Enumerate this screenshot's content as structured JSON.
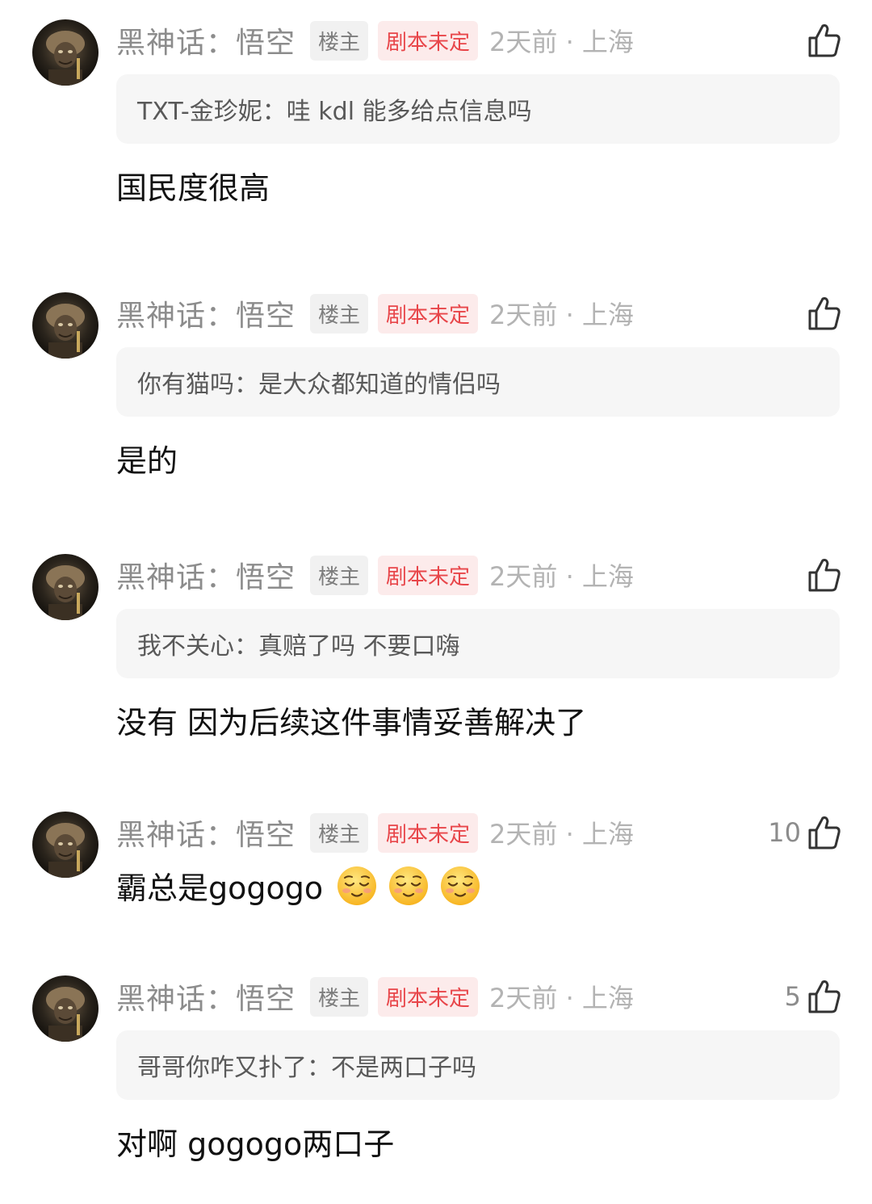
{
  "comments": [
    {
      "username": "黑神话：悟空",
      "owner_badge": "楼主",
      "flair": "剧本未定",
      "time_location": "2天前 · 上海",
      "likes": "",
      "quote": "TXT-金珍妮：哇 kdl 能多给点信息吗",
      "reply": "国民度很高"
    },
    {
      "username": "黑神话：悟空",
      "owner_badge": "楼主",
      "flair": "剧本未定",
      "time_location": "2天前 · 上海",
      "likes": "",
      "quote": "你有猫吗：是大众都知道的情侣吗",
      "reply": "是的"
    },
    {
      "username": "黑神话：悟空",
      "owner_badge": "楼主",
      "flair": "剧本未定",
      "time_location": "2天前 · 上海",
      "likes": "",
      "quote": "我不关心：真赔了吗 不要口嗨",
      "reply": "没有 因为后续这件事情妥善解决了"
    },
    {
      "username": "黑神话：悟空",
      "owner_badge": "楼主",
      "flair": "剧本未定",
      "time_location": "2天前 · 上海",
      "likes": "10",
      "quote": "",
      "reply": "霸总是gogogo",
      "emojis": [
        "relieved-face-emoji",
        "relieved-face-emoji",
        "relieved-face-emoji"
      ]
    },
    {
      "username": "黑神话：悟空",
      "owner_badge": "楼主",
      "flair": "剧本未定",
      "time_location": "2天前 · 上海",
      "likes": "5",
      "quote": "哥哥你咋又扑了：不是两口子吗",
      "reply": "对啊 gogogo两口子"
    }
  ],
  "colors": {
    "username": "#8c8c8c",
    "flair_text": "#e8464a",
    "flair_bg": "#fcebeb",
    "quote_bg": "#f6f6f6",
    "reply_text": "#111111"
  },
  "icons": {
    "like": "thumbs-up-icon",
    "avatar": "monkey-king-avatar"
  }
}
